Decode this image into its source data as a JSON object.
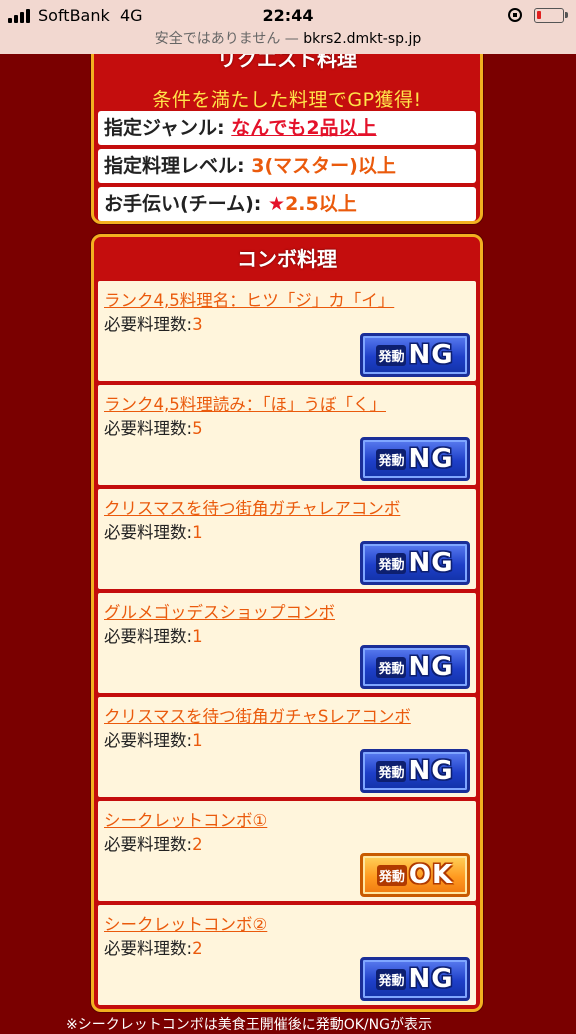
{
  "status_bar": {
    "carrier": "SoftBank",
    "network": "4G",
    "time": "22:44",
    "security_text": "安全ではありません —",
    "host": "bkrs2.dmkt-sp.jp"
  },
  "request": {
    "title": "リクエスト料理",
    "subtitle": "条件を満たした料理でGP獲得!",
    "rows": [
      {
        "label": "指定ジャンル:",
        "value": "なんでも2品以上"
      },
      {
        "label": "指定料理レベル:",
        "value": "3(マスター)以上"
      },
      {
        "label": "お手伝い(チーム):",
        "star": "★",
        "value": "2.5以上"
      }
    ]
  },
  "combo": {
    "title": "コンボ料理",
    "required_label": "必要料理数:",
    "items": [
      {
        "name": "ランク4,5料理名：ヒツ「ジ」カ「イ」",
        "count": "3",
        "button_kanji": "発動",
        "button_text": "NG"
      },
      {
        "name": "ランク4,5料理読み：「ほ」うぼ「く」",
        "count": "5",
        "button_kanji": "発動",
        "button_text": "NG"
      },
      {
        "name": "クリスマスを待つ街角ガチャレアコンボ",
        "count": "1",
        "button_kanji": "発動",
        "button_text": "NG"
      },
      {
        "name": "グルメゴッデスショップコンボ",
        "count": "1",
        "button_kanji": "発動",
        "button_text": "NG"
      },
      {
        "name": "クリスマスを待つ街角ガチャSレアコンボ",
        "count": "1",
        "button_kanji": "発動",
        "button_text": "NG"
      },
      {
        "name": "シークレットコンボ①",
        "count": "2",
        "button_kanji": "発動",
        "button_text": "OK"
      },
      {
        "name": "シークレットコンボ②",
        "count": "2",
        "button_kanji": "発動",
        "button_text": "NG"
      }
    ]
  },
  "footnote": "※シークレットコンボは美食王開催後に発動OK/NGが表示"
}
